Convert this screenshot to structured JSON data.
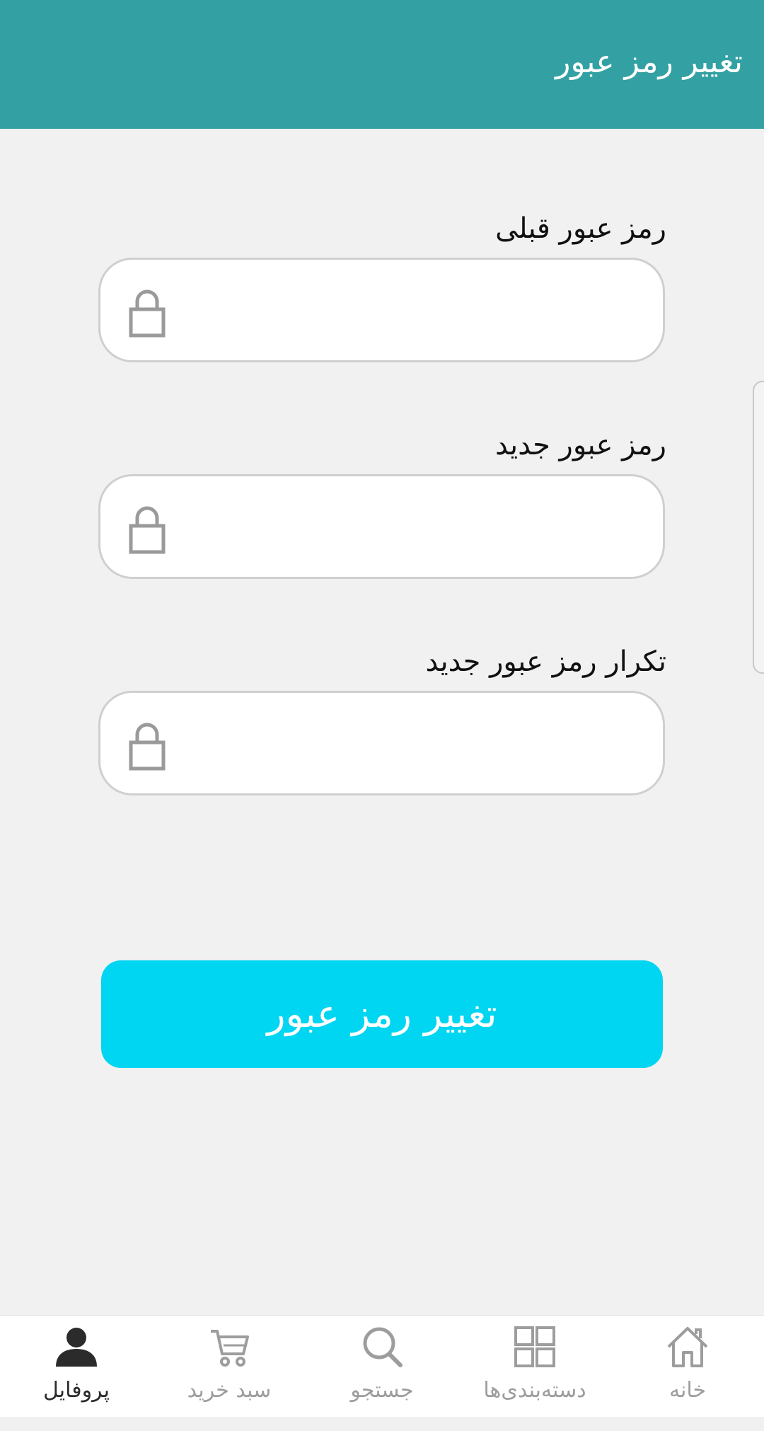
{
  "header": {
    "title": "تغییر رمز عبور"
  },
  "form": {
    "fields": [
      {
        "label": "رمز عبور قبلی",
        "value": "",
        "placeholder": ""
      },
      {
        "label": "رمز عبور جدید",
        "value": "",
        "placeholder": ""
      },
      {
        "label": "تکرار رمز عبور جدید",
        "value": "",
        "placeholder": ""
      }
    ],
    "field_icon": "lock-icon",
    "submit_label": "تغییر رمز عبور"
  },
  "bottom_nav": {
    "items": [
      {
        "label": "پروفایل",
        "icon": "user-icon",
        "active": true
      },
      {
        "label": "سبد خرید",
        "icon": "cart-icon",
        "active": false
      },
      {
        "label": "جستجو",
        "icon": "search-icon",
        "active": false
      },
      {
        "label": "دسته‌بندی‌ها",
        "icon": "grid-icon",
        "active": false
      },
      {
        "label": "خانه",
        "icon": "home-icon",
        "active": false
      }
    ]
  },
  "colors": {
    "header_bg": "#33a1a3",
    "button_bg": "#00d5f2",
    "page_bg": "#f1f1f1",
    "nav_active": "#2b2b2b",
    "nav_inactive": "#9d9d9d"
  }
}
